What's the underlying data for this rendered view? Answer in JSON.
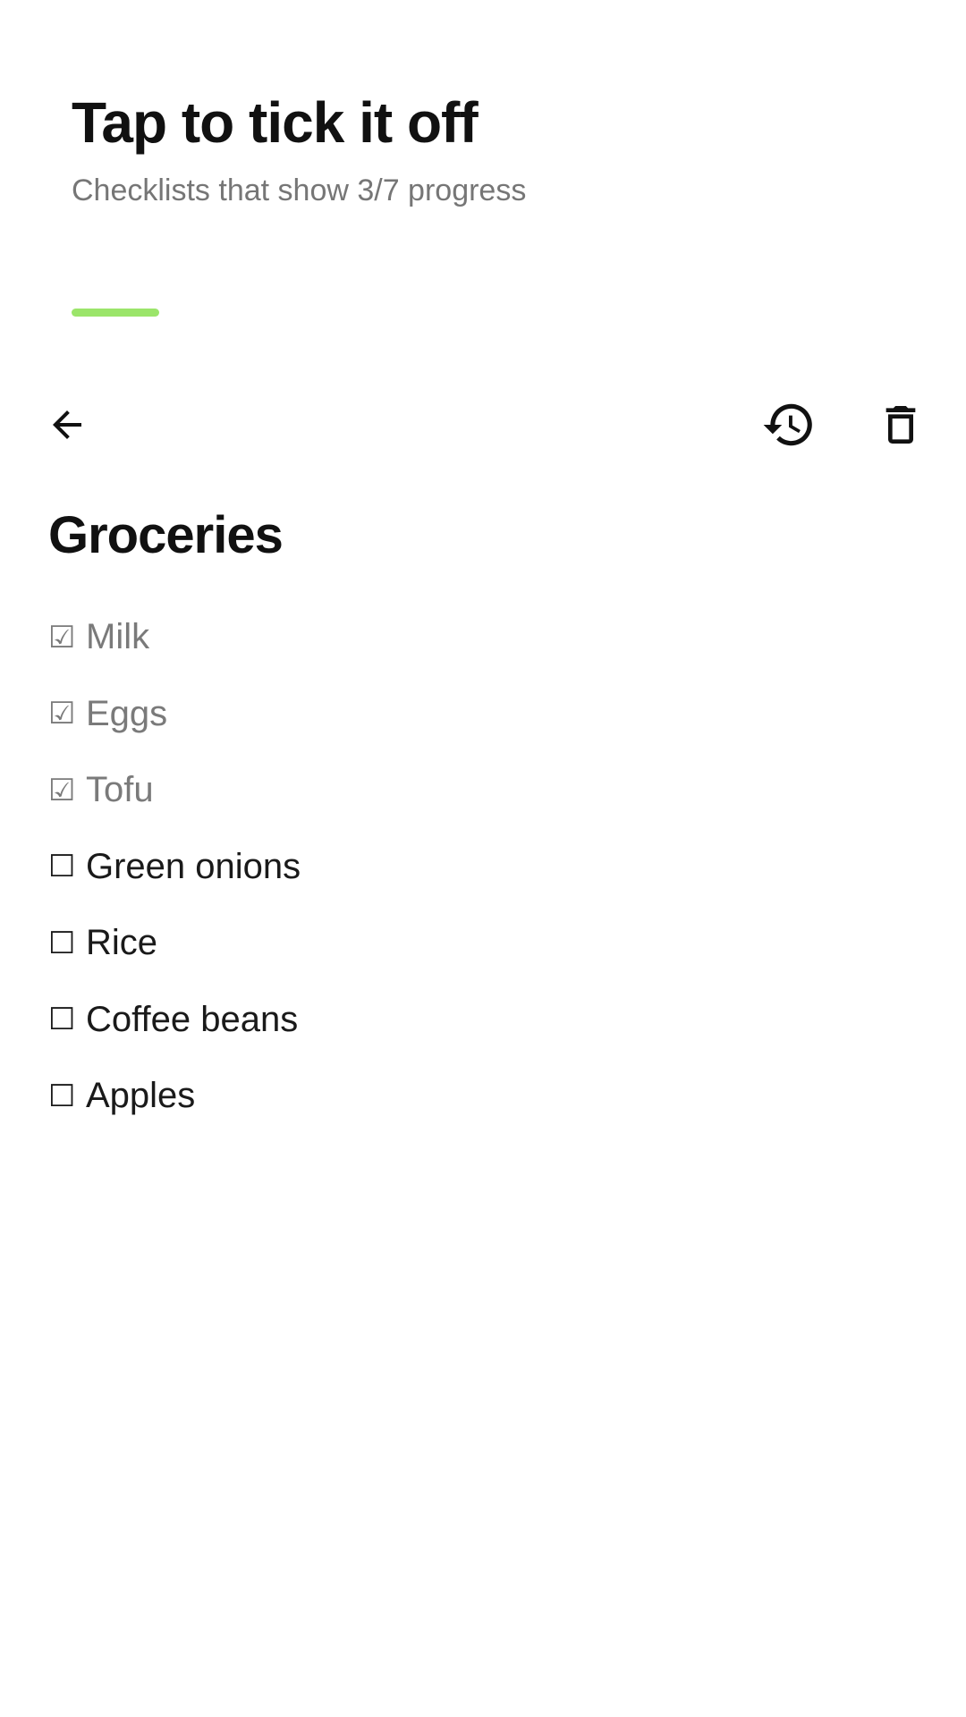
{
  "promo": {
    "title": "Tap to tick it off",
    "subtitle": "Checklists that show 3/7 progress",
    "accent_color": "#9be56a"
  },
  "toolbar": {
    "back_icon": "arrow-back-icon",
    "history_icon": "history-icon",
    "delete_icon": "trash-icon"
  },
  "list": {
    "title": "Groceries",
    "checked_glyph": "☑",
    "unchecked_glyph": "☐",
    "items": [
      {
        "label": "Milk",
        "checked": true
      },
      {
        "label": "Eggs",
        "checked": true
      },
      {
        "label": "Tofu",
        "checked": true
      },
      {
        "label": "Green onions",
        "checked": false
      },
      {
        "label": "Rice",
        "checked": false
      },
      {
        "label": "Coffee beans",
        "checked": false
      },
      {
        "label": "Apples",
        "checked": false
      }
    ]
  },
  "colors": {
    "checked_text": "#7a7a7a",
    "unchecked_text": "#1a1a1a",
    "accent": "#9be56a"
  }
}
